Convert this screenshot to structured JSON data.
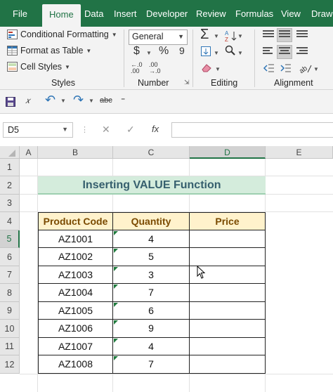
{
  "ribbon_tabs": [
    "File",
    "Home",
    "Data",
    "Insert",
    "Developer",
    "Review",
    "Formulas",
    "View",
    "Draw"
  ],
  "active_tab": "Home",
  "styles_group": {
    "conditional_formatting": "Conditional Formatting",
    "format_as_table": "Format as Table",
    "cell_styles": "Cell Styles",
    "label": "Styles"
  },
  "number_group": {
    "format_value": "General",
    "currency_symbol": "$",
    "percent_symbol": "%",
    "comma_symbol": "9",
    "label": "Number"
  },
  "editing_group": {
    "label": "Editing"
  },
  "alignment_group": {
    "label": "Alignment"
  },
  "formula_bar": {
    "name_box": "D5",
    "formula": ""
  },
  "columns": [
    "A",
    "B",
    "C",
    "D",
    "E"
  ],
  "rows": [
    "1",
    "2",
    "3",
    "4",
    "5",
    "6",
    "7",
    "8",
    "9",
    "10",
    "11",
    "12"
  ],
  "sheet": {
    "title": "Inserting VALUE Function",
    "headers": [
      "Product Code",
      "Quantity",
      "Price"
    ],
    "data": [
      {
        "code": "AZ1001",
        "qty": "4",
        "price": ""
      },
      {
        "code": "AZ1002",
        "qty": "5",
        "price": ""
      },
      {
        "code": "AZ1003",
        "qty": "3",
        "price": ""
      },
      {
        "code": "AZ1004",
        "qty": "7",
        "price": ""
      },
      {
        "code": "AZ1005",
        "qty": "6",
        "price": ""
      },
      {
        "code": "AZ1006",
        "qty": "9",
        "price": ""
      },
      {
        "code": "AZ1007",
        "qty": "4",
        "price": ""
      },
      {
        "code": "AZ1008",
        "qty": "7",
        "price": ""
      }
    ]
  },
  "colors": {
    "excel_green": "#217346",
    "header_fill": "#fff2cc",
    "title_fill": "#d4ecdc",
    "error_triangle": "#1e7a3c"
  }
}
